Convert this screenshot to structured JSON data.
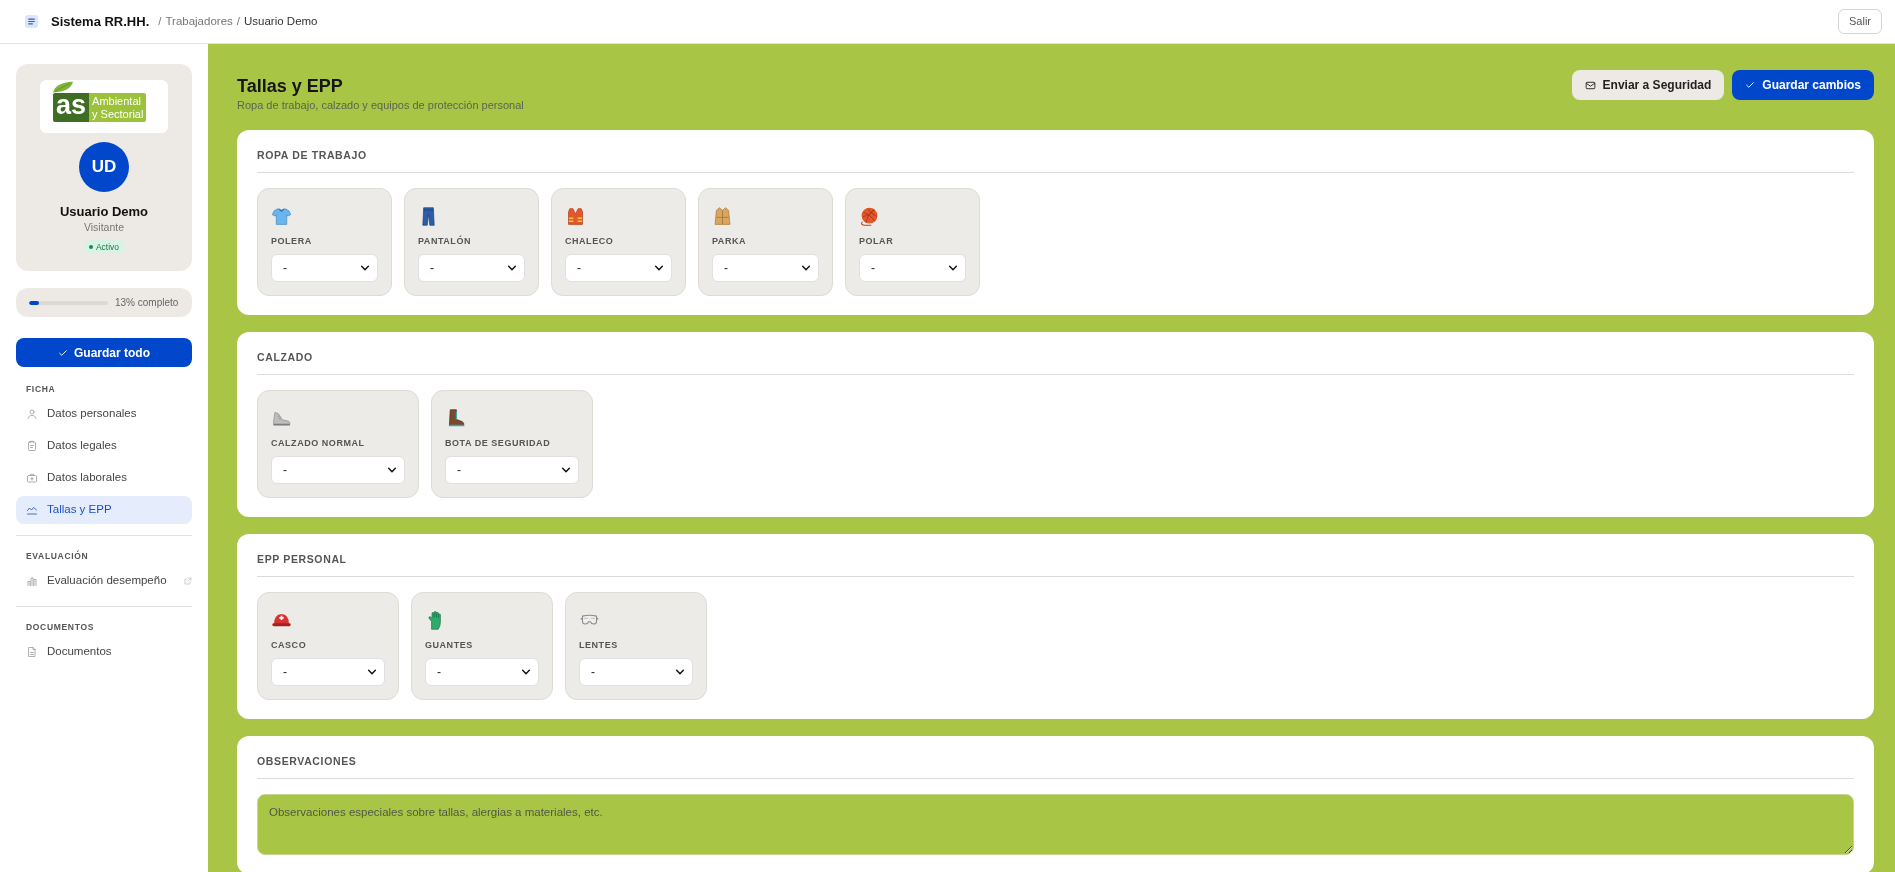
{
  "topbar": {
    "app_title": "Sistema RR.HH.",
    "breadcrumb": [
      {
        "separator": "/",
        "label": "Trabajadores",
        "current": false
      },
      {
        "separator": "/",
        "label": "Usuario Demo",
        "current": true
      }
    ],
    "logout_button": "Salir"
  },
  "sidebar": {
    "profile": {
      "logo": {
        "mark": "as",
        "line1": "Ambiental",
        "line2": "y Sectorial"
      },
      "initials": "UD",
      "name": "Usuario Demo",
      "role": "Visitante",
      "status": "Activo"
    },
    "progress": {
      "level": 0.13,
      "label": "13% completo"
    },
    "save_all_button": "Guardar todo",
    "nav": [
      {
        "heading": "FICHA",
        "items": [
          {
            "label": "Datos personales",
            "selected": false,
            "external": false
          },
          {
            "label": "Datos legales",
            "selected": false,
            "external": false
          },
          {
            "label": "Datos laborales",
            "selected": false,
            "external": false
          },
          {
            "label": "Tallas y EPP",
            "selected": true,
            "external": false
          }
        ]
      },
      {
        "heading": "EVALUACIÓN",
        "items": [
          {
            "label": "Evaluación desempeño",
            "selected": false,
            "external": true
          }
        ]
      },
      {
        "heading": "DOCUMENTOS",
        "items": [
          {
            "label": "Documentos",
            "selected": false,
            "external": false
          }
        ]
      }
    ]
  },
  "main": {
    "title": "Tallas y EPP",
    "subtitle": "Ropa de trabajo, calzado y equipos de protección personal",
    "buttons": [
      {
        "label": "Enviar a Seguridad",
        "kind": "secondary"
      },
      {
        "label": "Guardar cambios",
        "kind": "primary"
      }
    ],
    "sections": [
      {
        "title": "ROPA DE TRABAJO",
        "items": [
          {
            "label": "POLERA",
            "value": "-"
          },
          {
            "label": "PANTALÓN",
            "value": "-"
          },
          {
            "label": "CHALECO",
            "value": "-"
          },
          {
            "label": "PARKA",
            "value": "-"
          },
          {
            "label": "POLAR",
            "value": "-"
          }
        ]
      },
      {
        "title": "CALZADO",
        "items": [
          {
            "label": "CALZADO NORMAL",
            "value": "-"
          },
          {
            "label": "BOTA DE SEGURIDAD",
            "value": "-"
          }
        ]
      },
      {
        "title": "EPP PERSONAL",
        "items": [
          {
            "label": "CASCO",
            "value": "-"
          },
          {
            "label": "GUANTES",
            "value": "-"
          },
          {
            "label": "LENTES",
            "value": "-"
          }
        ]
      }
    ],
    "notes": {
      "title": "OBSERVACIONES",
      "placeholder": "Observaciones especiales sobre tallas, alergias a materiales, etc."
    }
  }
}
